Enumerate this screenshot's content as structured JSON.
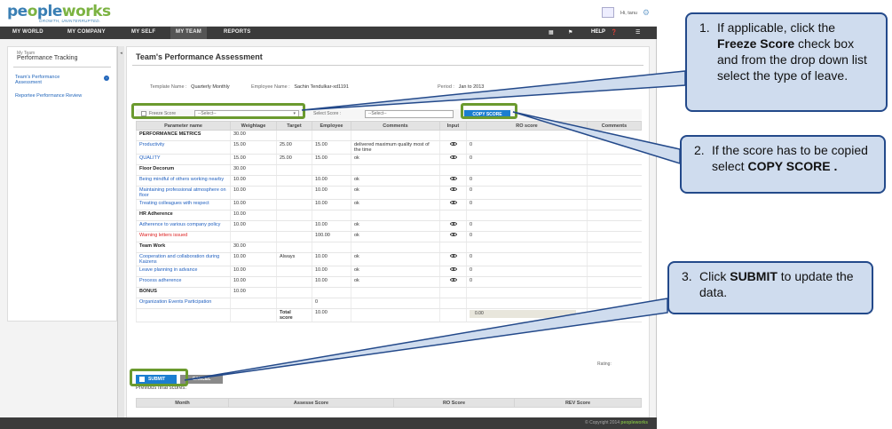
{
  "header": {
    "logo_part1": "pe",
    "logo_part2": "o",
    "logo_part3": "ple",
    "logo_part4": "works",
    "tagline": "GROWTH, UNINTERRUPTED.",
    "greeting": "Hi, tanu"
  },
  "nav": {
    "items": [
      "MY WORLD",
      "MY COMPANY",
      "MY SELF",
      "MY TEAM",
      "REPORTS"
    ],
    "help": "HELP"
  },
  "sidebar": {
    "small": "My Team",
    "title": "Performance Tracking",
    "link1_line1": "Team's Performance",
    "link1_line2": "Assessment",
    "link2": "Reportee Performance Review"
  },
  "main": {
    "title": "Team's Performance Assessment",
    "template_label": "Template Name :",
    "template_value": "Quarterly Monthly",
    "employee_label": "Employee Name :",
    "employee_value": "Sachin Tendulkar-xd1191",
    "period_label": "Period :",
    "period_value": "Jan to 2013",
    "freeze_label": "Freeze Score",
    "freeze_select": "--Select--",
    "select_score_label": "Select Score :",
    "select_score_value": "--Select--",
    "copy_score": "COPY SCORE",
    "columns": [
      "Parameter name",
      "Weightage",
      "Target",
      "Employee",
      "Comments",
      "Input",
      "RO score",
      "Comments"
    ],
    "total_label_1": "Total",
    "total_label_2": "score",
    "total_weight": "10.00",
    "total_ro": "0.00",
    "rating": "Rating:",
    "submit": "SUBMIT",
    "cancel": "CANCEL",
    "previous": "Previous final scores:",
    "prev_columns": [
      "Month",
      "Assesse Score",
      "RO Score",
      "REV Score"
    ]
  },
  "rows": [
    {
      "type": "cat",
      "name": "PERFORMANCE METRICS",
      "weight": "30.00"
    },
    {
      "type": "item",
      "name": "Productivity",
      "weight": "15.00",
      "target": "25.00",
      "emp": "15.00",
      "comment": "delivered maximum quality most of the time",
      "ro": "0"
    },
    {
      "type": "item",
      "name": "QUALITY",
      "weight": "15.00",
      "target": "25.00",
      "emp": "15.00",
      "comment": "ok",
      "ro": "0"
    },
    {
      "type": "cat",
      "name": "Floor Decorum",
      "weight": "30.00"
    },
    {
      "type": "item",
      "name": "Being mindful of others working nearby",
      "weight": "10.00",
      "target": "",
      "emp": "10.00",
      "comment": "ok",
      "ro": "0"
    },
    {
      "type": "item",
      "name": "Maintaining professional atmosphere on floor",
      "weight": "10.00",
      "target": "",
      "emp": "10.00",
      "comment": "ok",
      "ro": "0"
    },
    {
      "type": "item",
      "name": "Treating colleagues with respect",
      "weight": "10.00",
      "target": "",
      "emp": "10.00",
      "comment": "ok",
      "ro": "0"
    },
    {
      "type": "cat",
      "name": "HR Adherence",
      "weight": "10.00"
    },
    {
      "type": "item",
      "name": "Adherence to various company policy",
      "weight": "10.00",
      "target": "",
      "emp": "10.00",
      "comment": "ok",
      "ro": "0"
    },
    {
      "type": "red",
      "name": "Warning letters issued",
      "weight": "",
      "target": "",
      "emp": "100.00",
      "comment": "ok",
      "ro": "0"
    },
    {
      "type": "cat",
      "name": "Team Work",
      "weight": "30.00"
    },
    {
      "type": "item",
      "name": "Cooperation and collaboration during Kaizens",
      "weight": "10.00",
      "target": "Always",
      "emp": "10.00",
      "comment": "ok",
      "ro": "0"
    },
    {
      "type": "item",
      "name": "Leave planning in advance",
      "weight": "10.00",
      "target": "",
      "emp": "10.00",
      "comment": "ok",
      "ro": "0"
    },
    {
      "type": "item",
      "name": "Process adherence",
      "weight": "10.00",
      "target": "",
      "emp": "10.00",
      "comment": "ok",
      "ro": "0"
    },
    {
      "type": "cat",
      "name": "BONUS",
      "weight": "10.00"
    },
    {
      "type": "item",
      "name": "Organization Events Participation",
      "weight": "",
      "target": "",
      "emp": "0",
      "comment": "",
      "ro": ""
    }
  ],
  "footer": {
    "copyright": "© Copyright 2014",
    "brand": "peopleworks"
  },
  "callouts": {
    "c1_num": "1.",
    "c1_a": "If applicable, click the",
    "c1_b": "Freeze Score",
    "c1_c": " check box and from the drop down list select the type of leave.",
    "c2_num": "2.",
    "c2_a": "If the score has to be copied select ",
    "c2_b": "COPY SCORE .",
    "c3_num": "3.",
    "c3_a": "Click ",
    "c3_b": "SUBMIT",
    "c3_c": " to update the data."
  }
}
